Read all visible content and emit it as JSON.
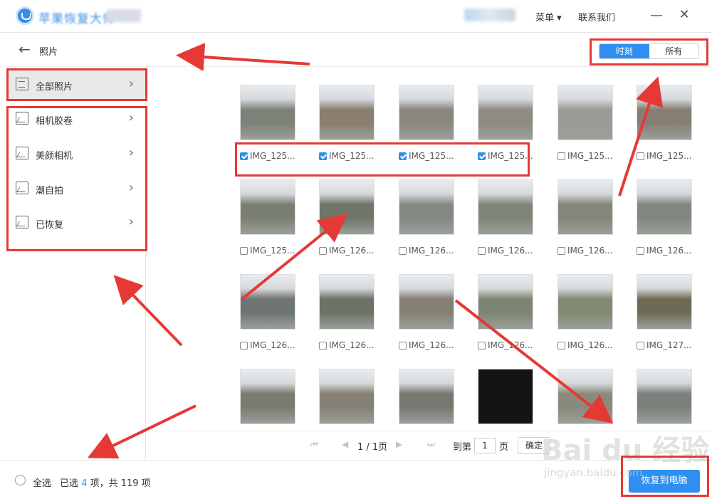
{
  "titlebar": {
    "app_name": "苹果恢复大师",
    "menu_label": "菜单 ▾",
    "contact_label": "联系我们",
    "minimize": "—",
    "close": "✕"
  },
  "header": {
    "back_icon": "←",
    "page_title": "照片",
    "view_tabs": [
      {
        "label": "时刻",
        "active": true
      },
      {
        "label": "所有",
        "active": false
      }
    ]
  },
  "sidebar": {
    "items": [
      {
        "label": "全部照片",
        "icon": "clipboard-icon",
        "active": true
      },
      {
        "label": "相机胶卷",
        "icon": "image-icon",
        "active": false
      },
      {
        "label": "美颜相机",
        "icon": "image-icon",
        "active": false
      },
      {
        "label": "潮自拍",
        "icon": "image-icon",
        "active": false
      },
      {
        "label": "已恢复",
        "icon": "image-icon",
        "active": false
      }
    ],
    "chevron": "›"
  },
  "photos": [
    {
      "label": "IMG_125...",
      "checked": true,
      "tone": "#7c8278"
    },
    {
      "label": "IMG_125...",
      "checked": true,
      "tone": "#8a7f70"
    },
    {
      "label": "IMG_125...",
      "checked": true,
      "tone": "#8b8680"
    },
    {
      "label": "IMG_125...",
      "checked": true,
      "tone": "#8e8b82"
    },
    {
      "label": "IMG_125...",
      "checked": false,
      "tone": "#9c9a96"
    },
    {
      "label": "IMG_125...",
      "checked": false,
      "tone": "#857e73"
    },
    {
      "label": "IMG_125...",
      "checked": false,
      "tone": "#7a7f72"
    },
    {
      "label": "IMG_126...",
      "checked": false,
      "tone": "#6f7569"
    },
    {
      "label": "IMG_126...",
      "checked": false,
      "tone": "#828a83"
    },
    {
      "label": "IMG_126...",
      "checked": false,
      "tone": "#7d8679"
    },
    {
      "label": "IMG_126...",
      "checked": false,
      "tone": "#838679"
    },
    {
      "label": "IMG_126...",
      "checked": false,
      "tone": "#7f8780"
    },
    {
      "label": "IMG_126...",
      "checked": false,
      "tone": "#6e7470"
    },
    {
      "label": "IMG_126...",
      "checked": false,
      "tone": "#6b7266"
    },
    {
      "label": "IMG_126...",
      "checked": false,
      "tone": "#857f74"
    },
    {
      "label": "IMG_126...",
      "checked": false,
      "tone": "#7c8570"
    },
    {
      "label": "IMG_126...",
      "checked": false,
      "tone": "#7f8a72"
    },
    {
      "label": "IMG_127...",
      "checked": false,
      "tone": "#6e6a55"
    },
    {
      "label": "",
      "checked": false,
      "tone": "#7a7a70"
    },
    {
      "label": "",
      "checked": false,
      "tone": "#858075"
    },
    {
      "label": "",
      "checked": false,
      "tone": "#777770"
    },
    {
      "label": "",
      "checked": false,
      "tone": "#141412"
    },
    {
      "label": "",
      "checked": false,
      "tone": "#8a8a7c"
    },
    {
      "label": "",
      "checked": false,
      "tone": "#7c807a"
    }
  ],
  "pager": {
    "page_text": "1 / 1页",
    "goto_label": "到第",
    "page_value": "1",
    "page_unit": "页",
    "confirm_label": "确定"
  },
  "footer": {
    "select_all_label": "全选",
    "selected_prefix": "已选",
    "selected_count": "4",
    "selected_suffix": "项，共 119 项",
    "restore_label": "恢复到电脑"
  },
  "watermark": {
    "brand": "Bai du 经验",
    "url": "jingyan.baidu.com"
  },
  "colors": {
    "accent": "#2e8ff0",
    "annotation": "#e53935"
  }
}
